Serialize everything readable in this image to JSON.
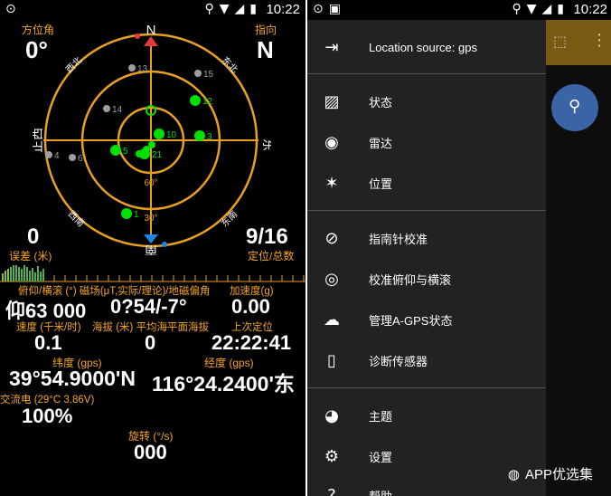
{
  "status": {
    "time": "10:22"
  },
  "left": {
    "azimuth_label": "方位角",
    "azimuth_value": "0°",
    "heading_label": "指向",
    "heading_value": "N",
    "compass": {
      "n": "N",
      "e": "东",
      "s": "南",
      "w": "正西",
      "ne": "东北",
      "nw": "西北",
      "se": "东南",
      "sw": "西南",
      "r60": "60°",
      "r30": "30°"
    },
    "sats": [
      {
        "id": "13",
        "color": "#9e9e9e"
      },
      {
        "id": "15",
        "color": "#9e9e9e"
      },
      {
        "id": "12",
        "color": "#00e000"
      },
      {
        "id": "14",
        "color": "#9e9e9e"
      },
      {
        "id": "10",
        "color": "#00e000"
      },
      {
        "id": "3",
        "color": "#00e000"
      },
      {
        "id": "4",
        "color": "#9e9e9e"
      },
      {
        "id": "6",
        "color": "#9e9e9e"
      },
      {
        "id": "5",
        "color": "#00e000"
      },
      {
        "id": "21",
        "color": "#00e000"
      },
      {
        "id": "1",
        "color": "#00e000"
      }
    ],
    "error_value": "0",
    "error_label": "误差 (米)",
    "fix_value": "9/16",
    "fix_label": "定位/总数",
    "row1_label": "俯仰/横滚 (°)   磁场(μT,实际/理论)/地磁偏角",
    "accel_label": "加速度(g)",
    "pitch_value": "仰63 000",
    "mag_value": "0?54/-7°",
    "accel_value": "0.00",
    "speed_label": "速度 (千米/时)",
    "alt_label": "海拔 (米) 平均海平面海拔",
    "lastfix_label": "上次定位",
    "speed_value": "0.1",
    "alt_value": "0",
    "lastfix_value": "22:22:41",
    "lat_label": "纬度 (gps)",
    "lon_label": "经度 (gps)",
    "lat_value": "39°54.9000'N",
    "lon_value": "116°24.2400'东",
    "battery_label": "交流电 (29°C 3.86V)",
    "battery_value": "100%",
    "rot_label": "旋转 (°/s)",
    "rot_value": "000"
  },
  "drawer": {
    "location_source": "Location source: gps",
    "items": [
      "状态",
      "雷达",
      "位置",
      "指南针校准",
      "校准俯仰与横滚",
      "管理A-GPS状态",
      "诊断传感器",
      "主题",
      "设置",
      "帮助"
    ]
  },
  "watermark": "APP优选集"
}
